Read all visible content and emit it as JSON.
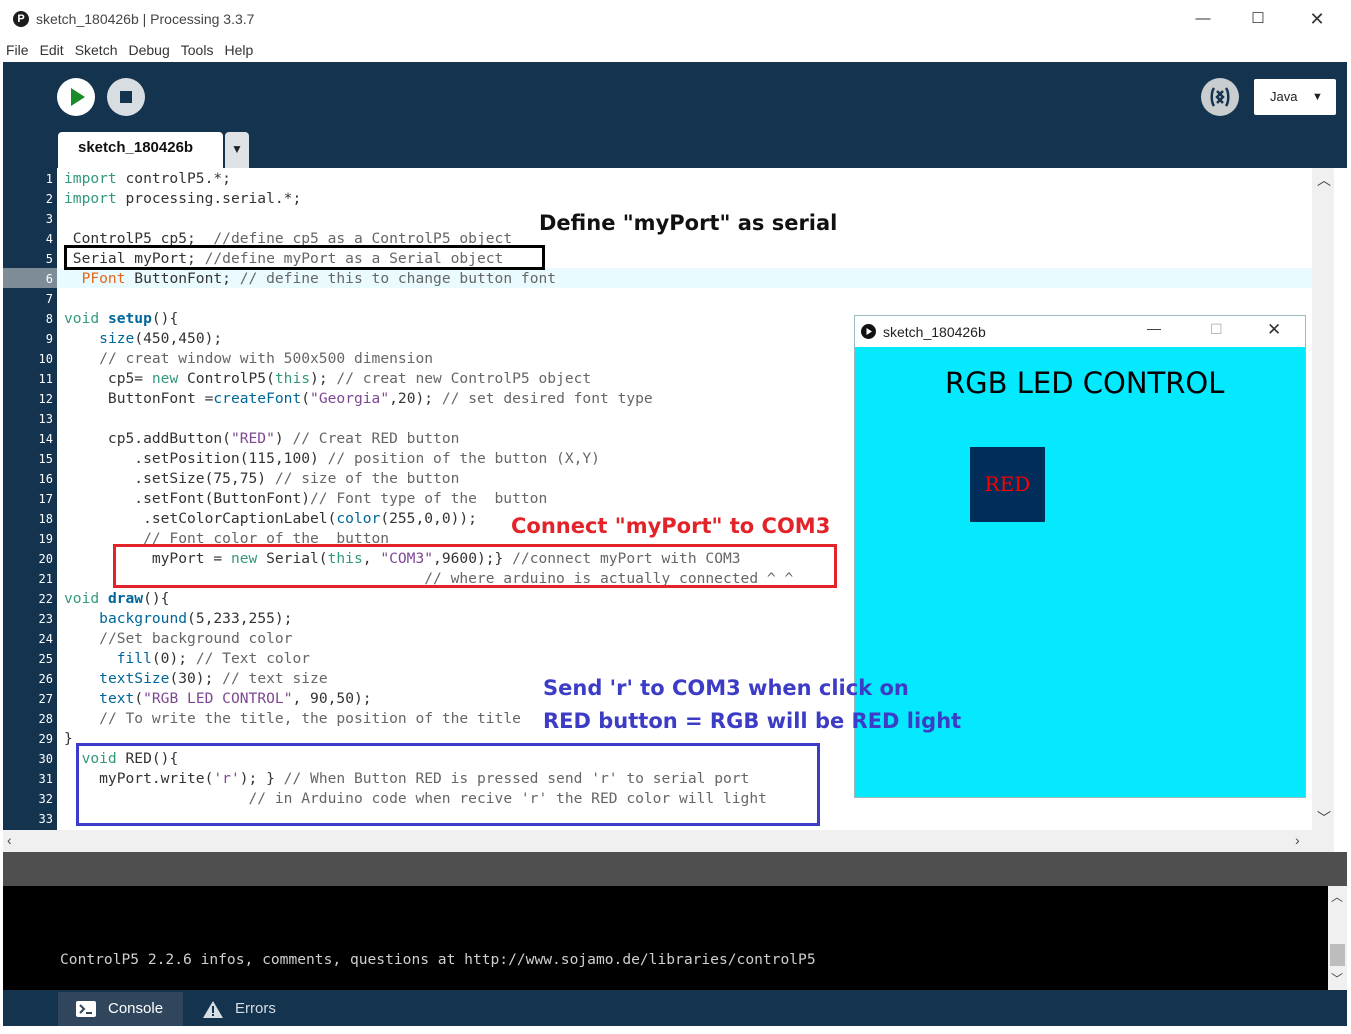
{
  "window": {
    "title": "sketch_180426b | Processing 3.3.7",
    "app_icon": "processing-icon",
    "controls": [
      "minimize-icon",
      "maximize-icon",
      "close-icon"
    ]
  },
  "menu": [
    "File",
    "Edit",
    "Sketch",
    "Debug",
    "Tools",
    "Help"
  ],
  "toolbar": {
    "run_icon": "play-icon",
    "stop_icon": "stop-icon",
    "debug_icon": "debugger-icon",
    "mode_label": "Java",
    "mode_caret": "▼"
  },
  "tabs": {
    "active": "sketch_180426b",
    "menu_caret": "▼"
  },
  "editor": {
    "current_line": 6,
    "line_numbers": [
      "1",
      "2",
      "3",
      "4",
      "5",
      "6",
      "7",
      "8",
      "9",
      "10",
      "11",
      "12",
      "13",
      "14",
      "15",
      "16",
      "17",
      "18",
      "19",
      "20",
      "21",
      "22",
      "23",
      "24",
      "25",
      "26",
      "27",
      "28",
      "29",
      "30",
      "31",
      "32",
      "33"
    ],
    "lines": [
      "import controlP5.*;",
      "import processing.serial.*;",
      "",
      " ControlP5 cp5;  //define cp5 as a ControlP5 object",
      " Serial myPort; //define myPort as a Serial object",
      "  PFont ButtonFont; // define this to change button font",
      "",
      "void setup(){",
      "    size(450,450);",
      "    // creat window with 500x500 dimension",
      "     cp5= new ControlP5(this); // creat new ControlP5 object",
      "     ButtonFont =createFont(\"Georgia\",20); // set desired font type",
      "",
      "     cp5.addButton(\"RED\") // Creat RED button",
      "        .setPosition(115,100) // position of the button (X,Y)",
      "        .setSize(75,75) // size of the button",
      "        .setFont(ButtonFont)// Font type of the  button",
      "         .setColorCaptionLabel(color(255,0,0));",
      "         // Font color of the  button",
      "          myPort = new Serial(this, \"COM3\",9600);} //connect myPort with COM3",
      "                                         // where arduino is actually connected ^_^",
      "void draw(){",
      "    background(5,233,255);",
      "    //Set background color",
      "      fill(0); // Text color",
      "    textSize(30); // text size",
      "    text(\"RGB LED CONTROL\", 90,50);",
      "    // To write the title, the position of the title",
      "}",
      "  void RED(){",
      "    myPort.write('r'); } // When Button RED is pressed send 'r' to serial port",
      "                     // in Arduino code when recive 'r' the RED color will light",
      ""
    ]
  },
  "annotations": {
    "define_label": "Define \"myPort\" as serial",
    "connect_label": "Connect \"myPort\" to COM3",
    "send_label_line1": "Send 'r' to COM3 when click on",
    "send_label_line2": "RED button = RGB will be RED light",
    "colors": {
      "black": "#000000",
      "red": "#e3232a",
      "blue": "#3c3cc6"
    }
  },
  "sketch_window": {
    "title": "sketch_180426b",
    "heading": "RGB LED CONTROL",
    "button_label": "RED",
    "background": "#05e9ff",
    "button_color": "#002d5a",
    "caption_color": "#ff0000"
  },
  "console": {
    "message": "ControlP5 2.2.6 infos, comments, questions at http://www.sojamo.de/libraries/controlP5"
  },
  "bottom_tabs": {
    "console": "Console",
    "errors": "Errors"
  }
}
